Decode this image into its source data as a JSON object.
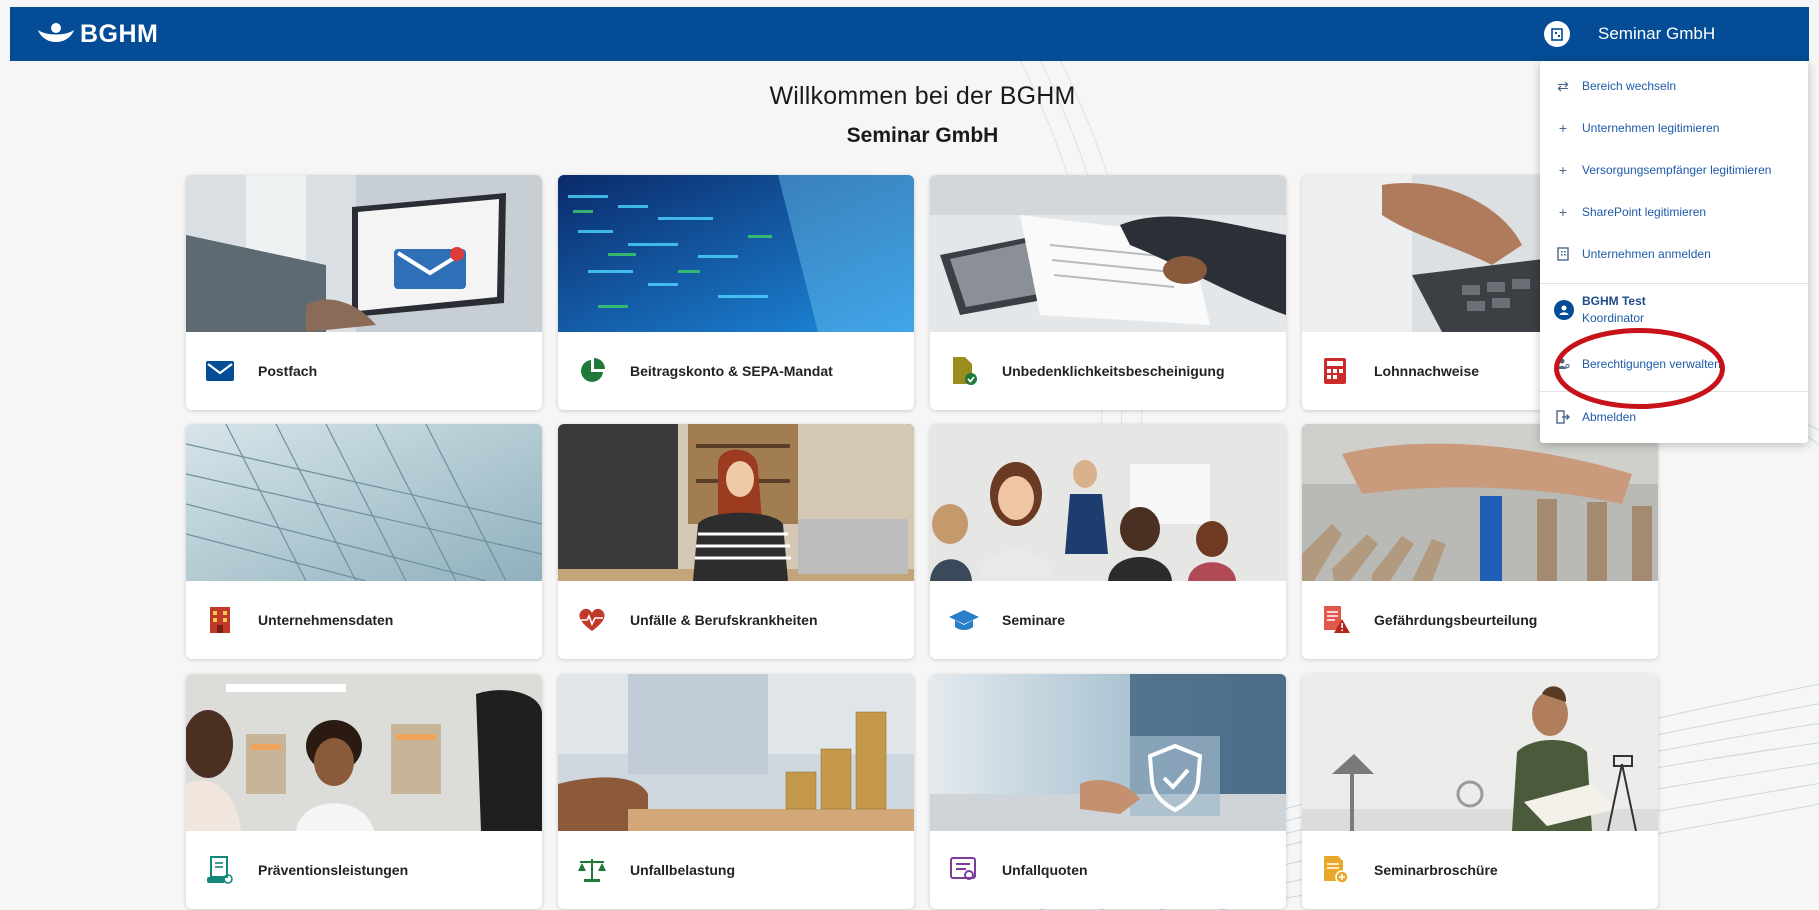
{
  "header": {
    "logo_text": "BGHM",
    "company_name": "Seminar GmbH"
  },
  "main": {
    "title": "Willkommen bei der BGHM",
    "subtitle": "Seminar GmbH"
  },
  "tiles": [
    {
      "label": "Postfach",
      "icon": "mail-icon"
    },
    {
      "label": "Beitragskonto & SEPA-Mandat",
      "icon": "pie-chart-icon"
    },
    {
      "label": "Unbedenklichkeitsbescheinigung",
      "icon": "document-check-icon"
    },
    {
      "label": "Lohnnachweise",
      "icon": "calculator-icon"
    },
    {
      "label": "Unternehmensdaten",
      "icon": "building-icon"
    },
    {
      "label": "Unfälle & Berufskrankheiten",
      "icon": "heart-pulse-icon"
    },
    {
      "label": "Seminare",
      "icon": "graduation-cap-icon"
    },
    {
      "label": "Gefährdungsbeurteilung",
      "icon": "document-warning-icon"
    },
    {
      "label": "Präventionsleistungen",
      "icon": "prevention-icon"
    },
    {
      "label": "Unfallbelastung",
      "icon": "scales-icon"
    },
    {
      "label": "Unfallquoten",
      "icon": "quota-list-icon"
    },
    {
      "label": "Seminarbroschüre",
      "icon": "brochure-icon"
    }
  ],
  "dropdown": {
    "items": [
      {
        "label": "Bereich wechseln",
        "icon": "swap-icon"
      },
      {
        "label": "Unternehmen legitimieren",
        "icon": "plus-icon"
      },
      {
        "label": "Versorgungsempfänger legitimieren",
        "icon": "plus-icon"
      },
      {
        "label": "SharePoint legitimieren",
        "icon": "plus-icon"
      },
      {
        "label": "Unternehmen anmelden",
        "icon": "building-icon"
      }
    ],
    "user": {
      "name": "BGHM Test",
      "role": "Koordinator"
    },
    "permissions_label": "Berechtigungen verwalten",
    "logout_label": "Abmelden"
  },
  "colors": {
    "brand": "#054c96",
    "link": "#1e5aa8",
    "highlight": "#c8121a"
  }
}
